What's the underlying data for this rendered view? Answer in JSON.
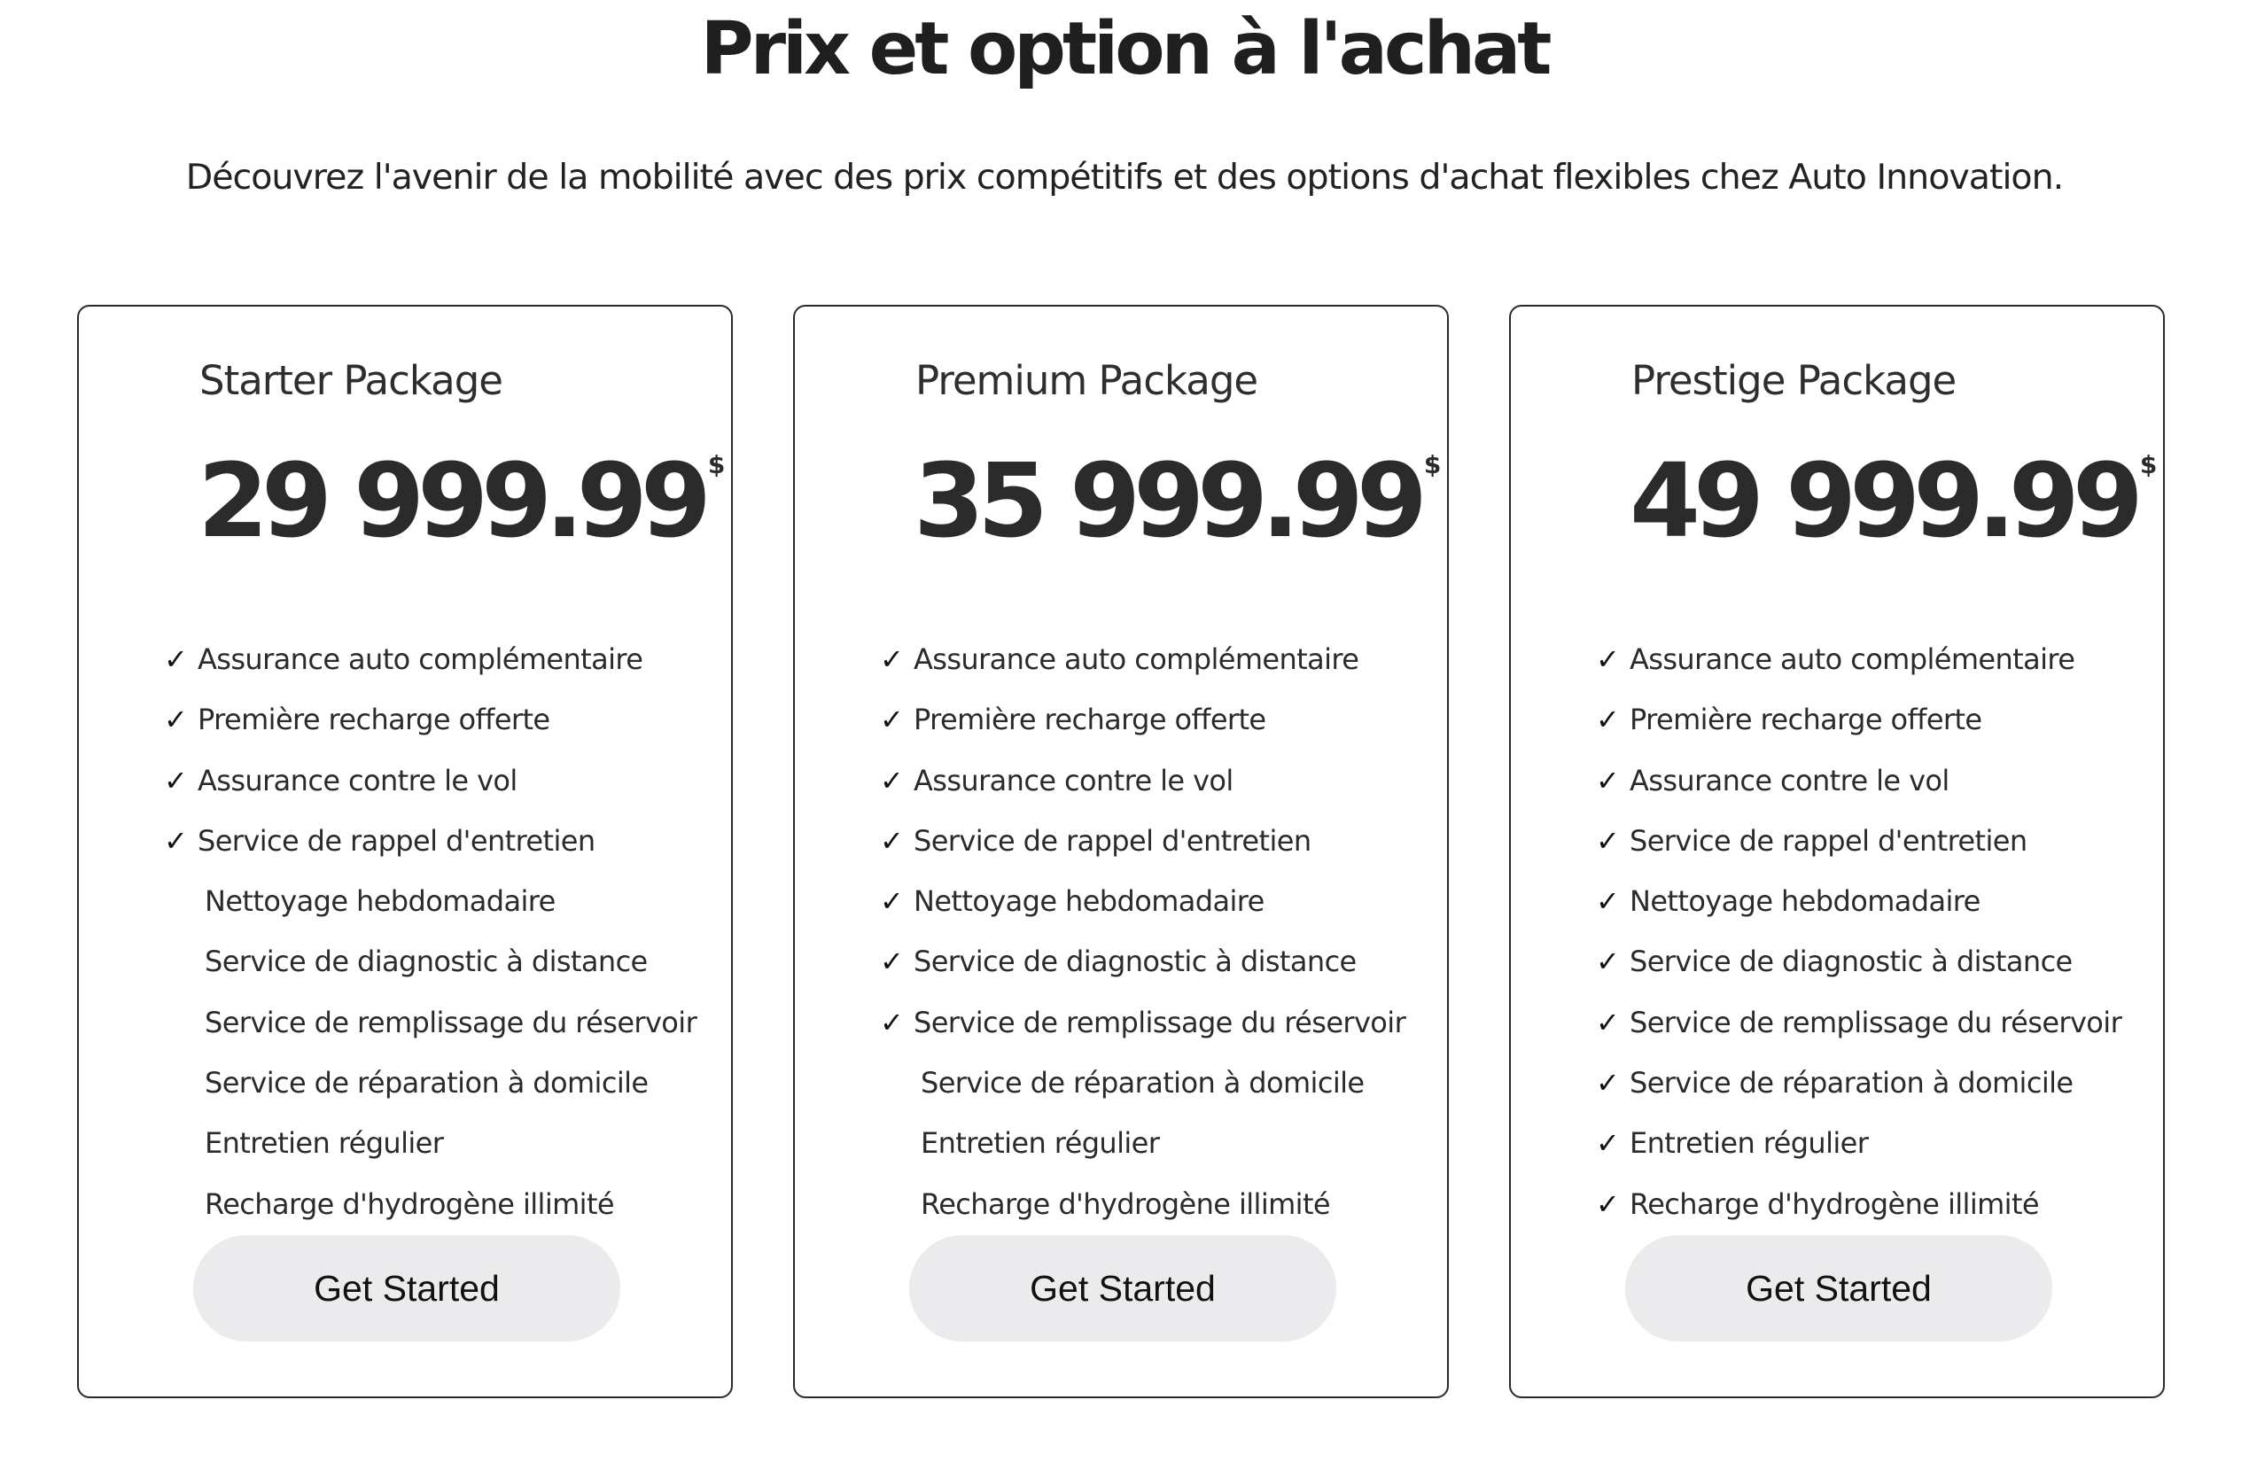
{
  "header": {
    "title": "Prix et option à l'achat",
    "subtitle": "Découvrez l'avenir de la mobilité avec des prix compétitifs et des options d'achat flexibles chez Auto Innovation."
  },
  "check_symbol": "✓",
  "packages": [
    {
      "name": "Starter Package",
      "price": "29 999.99",
      "currency": "$",
      "cta_label": "Get Started",
      "features": [
        {
          "label": "Assurance auto complémentaire",
          "included": true
        },
        {
          "label": "Première recharge offerte",
          "included": true
        },
        {
          "label": "Assurance contre le vol",
          "included": true
        },
        {
          "label": "Service de rappel d'entretien",
          "included": true
        },
        {
          "label": "Nettoyage hebdomadaire",
          "included": false
        },
        {
          "label": "Service de diagnostic à distance",
          "included": false
        },
        {
          "label": "Service de remplissage du réservoir",
          "included": false
        },
        {
          "label": "Service de réparation à domicile",
          "included": false
        },
        {
          "label": "Entretien régulier",
          "included": false
        },
        {
          "label": "Recharge d'hydrogène illimité",
          "included": false
        }
      ]
    },
    {
      "name": "Premium Package",
      "price": "35 999.99",
      "currency": "$",
      "cta_label": "Get Started",
      "features": [
        {
          "label": "Assurance auto complémentaire",
          "included": true
        },
        {
          "label": "Première recharge offerte",
          "included": true
        },
        {
          "label": "Assurance contre le vol",
          "included": true
        },
        {
          "label": "Service de rappel d'entretien",
          "included": true
        },
        {
          "label": "Nettoyage hebdomadaire",
          "included": true
        },
        {
          "label": "Service de diagnostic à distance",
          "included": true
        },
        {
          "label": "Service de remplissage du réservoir",
          "included": true
        },
        {
          "label": "Service de réparation à domicile",
          "included": false
        },
        {
          "label": "Entretien régulier",
          "included": false
        },
        {
          "label": "Recharge d'hydrogène illimité",
          "included": false
        }
      ]
    },
    {
      "name": "Prestige Package",
      "price": "49 999.99",
      "currency": "$",
      "cta_label": "Get Started",
      "features": [
        {
          "label": "Assurance auto complémentaire",
          "included": true
        },
        {
          "label": "Première recharge offerte",
          "included": true
        },
        {
          "label": "Assurance contre le vol",
          "included": true
        },
        {
          "label": "Service de rappel d'entretien",
          "included": true
        },
        {
          "label": "Nettoyage hebdomadaire",
          "included": true
        },
        {
          "label": "Service de diagnostic à distance",
          "included": true
        },
        {
          "label": "Service de remplissage du réservoir",
          "included": true
        },
        {
          "label": "Service de réparation à domicile",
          "included": true
        },
        {
          "label": "Entretien régulier",
          "included": true
        },
        {
          "label": "Recharge d'hydrogène illimité",
          "included": true
        }
      ]
    }
  ]
}
